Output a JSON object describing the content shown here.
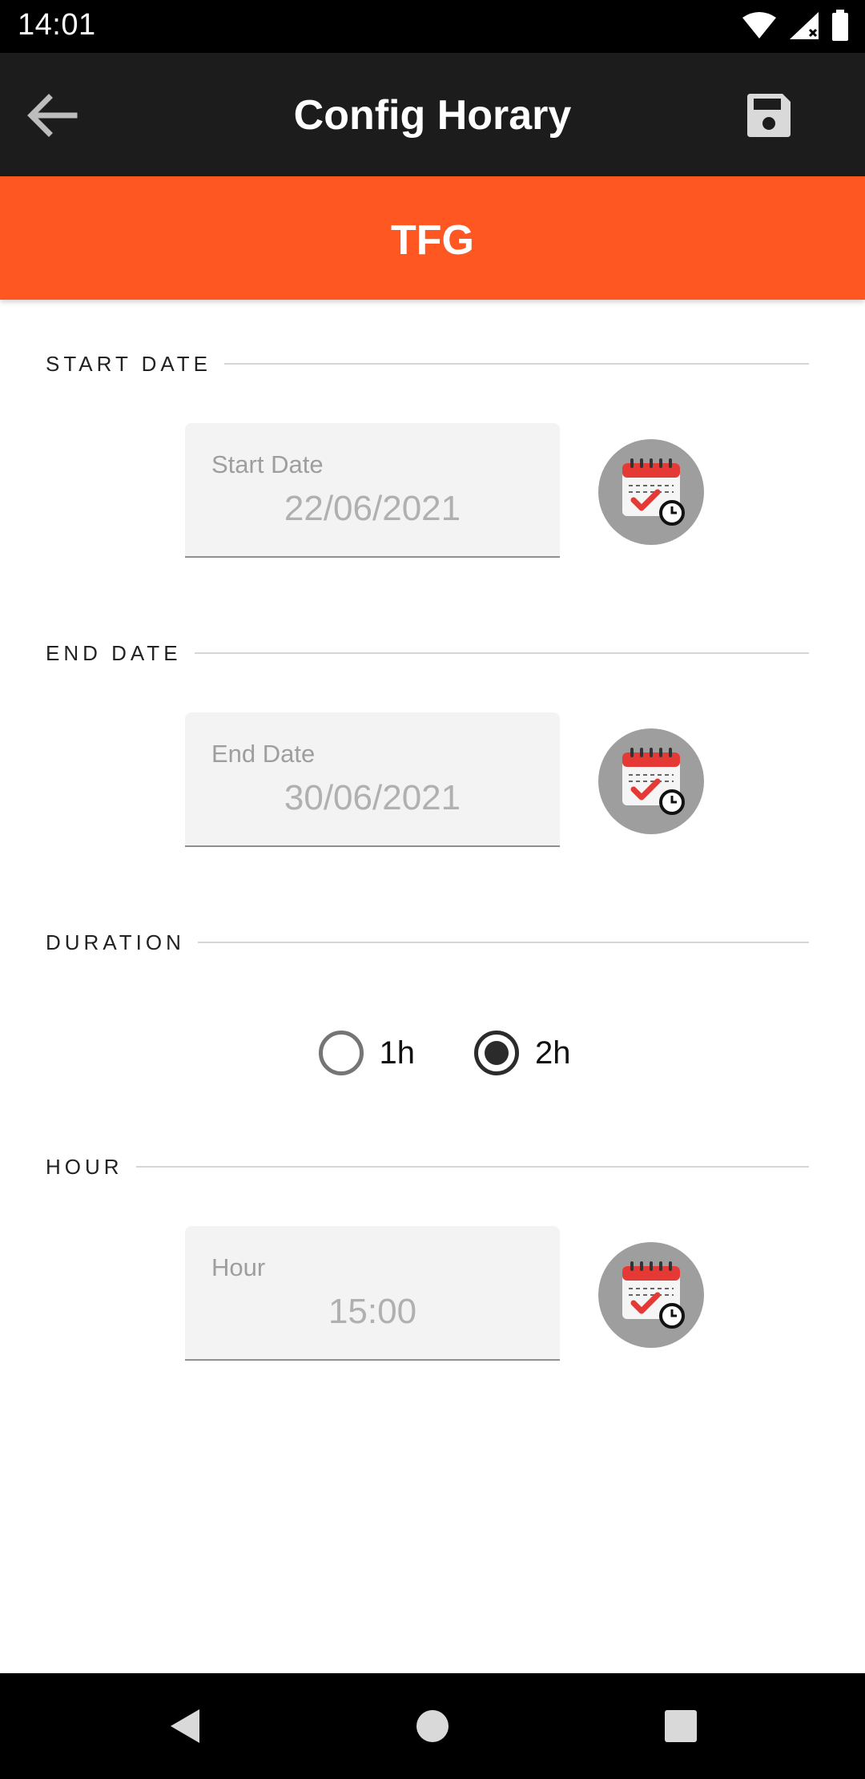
{
  "status_bar": {
    "time": "14:01"
  },
  "app_bar": {
    "title": "Config Horary"
  },
  "subject": {
    "name": "TFG"
  },
  "start_date": {
    "section_label": "START DATE",
    "field_label": "Start Date",
    "value": "22/06/2021"
  },
  "end_date": {
    "section_label": "END DATE",
    "field_label": "End Date",
    "value": "30/06/2021"
  },
  "duration": {
    "section_label": "DURATION",
    "options": [
      {
        "label": "1h",
        "selected": false
      },
      {
        "label": "2h",
        "selected": true
      }
    ]
  },
  "hour": {
    "section_label": "HOUR",
    "field_label": "Hour",
    "value": "15:00"
  },
  "colors": {
    "app_bar": "#1c1c1c",
    "accent": "#ff5722",
    "field_background": "#f3f3f3",
    "picker_button": "#9e9e9e",
    "calendar_red": "#e53935"
  },
  "icons": {
    "back": "arrow-left-icon",
    "save": "floppy-disk-icon",
    "calendar": "calendar-clock-icon",
    "nav_back": "triangle-back-icon",
    "nav_home": "circle-home-icon",
    "nav_recents": "square-recents-icon"
  }
}
